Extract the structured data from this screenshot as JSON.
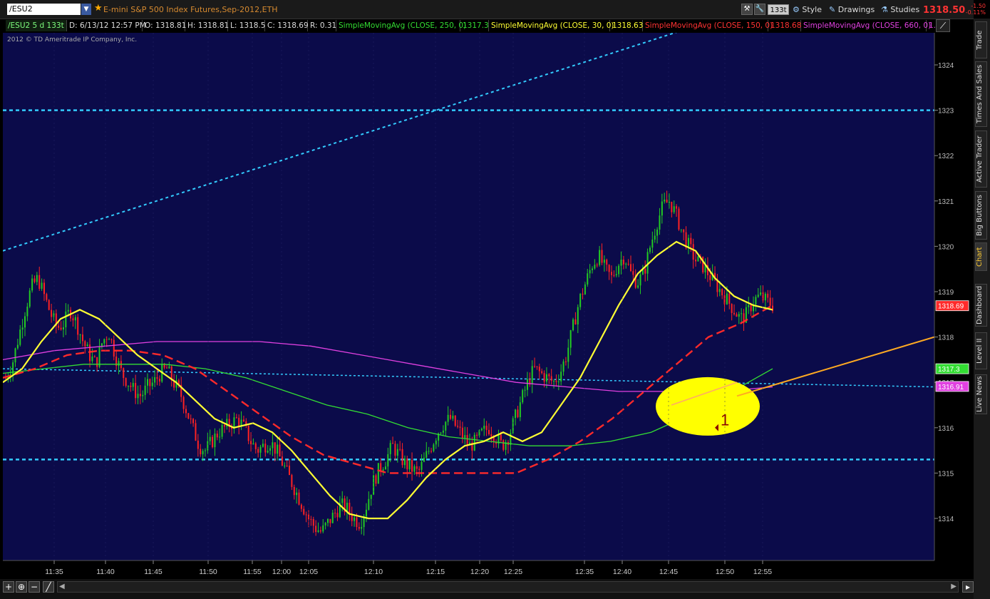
{
  "header": {
    "symbol": "/ESU2",
    "instrument_title": "E-mini S&P 500 Index Futures,Sep-2012,ETH",
    "tick_badge": "133t",
    "style_label": "Style",
    "drawings_label": "Drawings",
    "studies_label": "Studies",
    "last_price": "1318.50",
    "change_abs": "-1.50",
    "change_pct": "-0.11%"
  },
  "infobar": {
    "symbol_info": "/ESU2 5 d 133t",
    "date": "D: 6/13/12 12:57 PM",
    "open": "O: 1318.81",
    "high": "H: 1318.81",
    "low": "L: 1318.5",
    "close": "C: 1318.69",
    "range": "R: 0.31",
    "sma250_label": "SimpleMovingAvg (CLOSE, 250, 0)",
    "sma250_value": "1317.3",
    "sma30_label": "SimpleMovingAvg (CLOSE, 30, 0)",
    "sma30_value": "1318.63",
    "sma150_label": "SimpleMovingAvg (CLOSE, 150, 0)",
    "sma150_value": "1318.68",
    "sma660_label": "SimpleMovingAvg (CLOSE, 660, 0)",
    "sma660_value": "1."
  },
  "copyright": "2012 © TD Ameritrade IP Company, Inc.",
  "right_tabs": [
    "Trade",
    "Times And Sales",
    "Active Trader",
    "Big Buttons",
    "Chart",
    "Dashboard",
    "Level II",
    "Live News"
  ],
  "colors": {
    "background": "#0b0b4a",
    "sma30": "#ffff33",
    "sma150": "#ff2a2a",
    "sma250": "#33dd33",
    "sma660": "#e040e0",
    "levels": "#33ccff",
    "trendline": "#ffaa22",
    "candle_up": "#22cc22",
    "candle_down": "#ff2222",
    "marker_fill": "#ffff00"
  },
  "chart_data": {
    "type": "candlestick",
    "x_ticks": [
      "11:35",
      "11:40",
      "11:45",
      "11:50",
      "11:55",
      "12:00",
      "12:05",
      "12:10",
      "12:15",
      "12:20",
      "12:25",
      "12:35",
      "12:40",
      "12:45",
      "12:50",
      "12:55"
    ],
    "y_ticks": [
      1314,
      1315,
      1316,
      1317,
      1318,
      1319,
      1320,
      1321,
      1322,
      1323,
      1324
    ],
    "ylim": [
      1313.0,
      1325.2
    ],
    "close_path": [
      1317.1,
      1317.4,
      1318.0,
      1318.6,
      1319.1,
      1319.3,
      1318.9,
      1318.5,
      1318.2,
      1318.3,
      1318.6,
      1318.3,
      1317.9,
      1317.6,
      1317.4,
      1317.9,
      1318.1,
      1317.6,
      1317.2,
      1317.0,
      1316.8,
      1316.7,
      1316.9,
      1317.0,
      1317.2,
      1317.3,
      1317.0,
      1316.8,
      1316.4,
      1316.0,
      1315.6,
      1315.5,
      1315.7,
      1315.9,
      1316.0,
      1316.1,
      1316.2,
      1316.0,
      1315.7,
      1315.5,
      1315.6,
      1315.7,
      1315.5,
      1315.2,
      1314.9,
      1314.6,
      1314.3,
      1314.0,
      1313.8,
      1313.7,
      1313.9,
      1314.1,
      1314.3,
      1314.2,
      1314.0,
      1313.9,
      1314.3,
      1314.8,
      1315.1,
      1315.3,
      1315.6,
      1315.4,
      1315.2,
      1315.1,
      1315.0,
      1315.3,
      1315.6,
      1315.9,
      1316.1,
      1316.2,
      1316.0,
      1315.8,
      1315.6,
      1315.7,
      1315.9,
      1316.0,
      1315.8,
      1315.6,
      1315.8,
      1316.2,
      1316.6,
      1317.0,
      1317.3,
      1317.2,
      1317.1,
      1317.0,
      1317.2,
      1317.6,
      1318.2,
      1318.8,
      1319.2,
      1319.6,
      1319.8,
      1319.5,
      1319.3,
      1319.6,
      1319.8,
      1319.4,
      1319.2,
      1319.4,
      1320.0,
      1320.5,
      1320.9,
      1321.0,
      1320.7,
      1320.3,
      1320.0,
      1319.7,
      1319.6,
      1319.4,
      1319.2,
      1319.0,
      1318.8,
      1318.6,
      1318.4,
      1318.5,
      1318.8,
      1318.9,
      1318.8,
      1318.7
    ],
    "sma30": [
      1317.0,
      1317.3,
      1317.9,
      1318.4,
      1318.6,
      1318.4,
      1318.0,
      1317.6,
      1317.3,
      1317.0,
      1316.6,
      1316.2,
      1316.0,
      1316.1,
      1315.9,
      1315.5,
      1315.0,
      1314.5,
      1314.1,
      1314.0,
      1314.0,
      1314.4,
      1314.9,
      1315.3,
      1315.6,
      1315.7,
      1315.9,
      1315.7,
      1315.9,
      1316.5,
      1317.1,
      1317.9,
      1318.7,
      1319.4,
      1319.8,
      1320.1,
      1319.9,
      1319.3,
      1318.9,
      1318.7,
      1318.6
    ],
    "sma150": [
      1317.1,
      1317.3,
      1317.6,
      1317.7,
      1317.7,
      1317.6,
      1317.3,
      1316.8,
      1316.3,
      1315.8,
      1315.4,
      1315.2,
      1315.0,
      1315.0,
      1315.0,
      1315.0,
      1315.0,
      1315.3,
      1315.7,
      1316.2,
      1316.8,
      1317.4,
      1318.0,
      1318.3,
      1318.7
    ],
    "sma250": [
      1317.2,
      1317.3,
      1317.4,
      1317.4,
      1317.4,
      1317.3,
      1317.1,
      1316.8,
      1316.5,
      1316.3,
      1316.0,
      1315.8,
      1315.7,
      1315.6,
      1315.6,
      1315.7,
      1315.9,
      1316.3,
      1316.8,
      1317.3
    ],
    "sma660": [
      1317.5,
      1317.7,
      1317.8,
      1317.9,
      1317.9,
      1317.9,
      1317.8,
      1317.6,
      1317.4,
      1317.2,
      1317.0,
      1316.9,
      1316.8,
      1316.8,
      1316.8,
      1316.9
    ],
    "h_levels": [
      1323.0,
      1315.3
    ],
    "dotted_diagonal": [
      1319.9,
      1325.0
    ],
    "sr_line": [
      1317.3,
      1316.9
    ],
    "trendline": [
      1316.7,
      1318.0
    ],
    "price_tags": [
      {
        "label": "1318.69",
        "value": 1318.69,
        "color": "#ff2a2a"
      },
      {
        "label": "1317.3",
        "value": 1317.3,
        "color": "#33dd33"
      },
      {
        "label": "1316.91",
        "value": 1316.91,
        "color": "#e040e0"
      }
    ],
    "annotation": "1"
  }
}
